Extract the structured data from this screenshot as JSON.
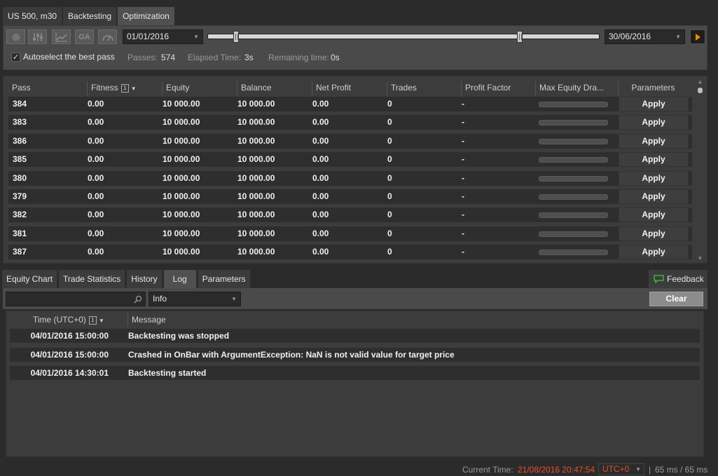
{
  "top_tabs": [
    {
      "label": "US 500, m30"
    },
    {
      "label": "Backtesting"
    },
    {
      "label": "Optimization",
      "active": true
    }
  ],
  "optimization": {
    "tool_icons": [
      "gear-icon",
      "sliders-icon",
      "line-chart-icon",
      "ga-icon",
      "speedometer-icon"
    ],
    "ga_label": "GA",
    "start_date": "01/01/2016",
    "end_date": "30/06/2016",
    "autoselect_label": "Autoselect the best pass",
    "autoselect_checked": true,
    "passes_label": "Passes:",
    "passes_value": "574",
    "elapsed_label": "Elapsed Time:",
    "elapsed_value": "3s",
    "remaining_label": "Remaining time:",
    "remaining_value": "0s"
  },
  "passes_table": {
    "columns": [
      "Pass",
      "Fitness",
      "Equity",
      "Balance",
      "Net Profit",
      "Trades",
      "Profit Factor",
      "Max Equity Dra...",
      "Parameters"
    ],
    "fitness_sort_index": "1",
    "apply_label": "Apply",
    "rows": [
      {
        "pass": "384",
        "fitness": "0.00",
        "equity": "10 000.00",
        "balance": "10 000.00",
        "net_profit": "0.00",
        "trades": "0",
        "profit_factor": "-"
      },
      {
        "pass": "383",
        "fitness": "0.00",
        "equity": "10 000.00",
        "balance": "10 000.00",
        "net_profit": "0.00",
        "trades": "0",
        "profit_factor": "-"
      },
      {
        "pass": "386",
        "fitness": "0.00",
        "equity": "10 000.00",
        "balance": "10 000.00",
        "net_profit": "0.00",
        "trades": "0",
        "profit_factor": "-"
      },
      {
        "pass": "385",
        "fitness": "0.00",
        "equity": "10 000.00",
        "balance": "10 000.00",
        "net_profit": "0.00",
        "trades": "0",
        "profit_factor": "-"
      },
      {
        "pass": "380",
        "fitness": "0.00",
        "equity": "10 000.00",
        "balance": "10 000.00",
        "net_profit": "0.00",
        "trades": "0",
        "profit_factor": "-"
      },
      {
        "pass": "379",
        "fitness": "0.00",
        "equity": "10 000.00",
        "balance": "10 000.00",
        "net_profit": "0.00",
        "trades": "0",
        "profit_factor": "-"
      },
      {
        "pass": "382",
        "fitness": "0.00",
        "equity": "10 000.00",
        "balance": "10 000.00",
        "net_profit": "0.00",
        "trades": "0",
        "profit_factor": "-"
      },
      {
        "pass": "381",
        "fitness": "0.00",
        "equity": "10 000.00",
        "balance": "10 000.00",
        "net_profit": "0.00",
        "trades": "0",
        "profit_factor": "-"
      },
      {
        "pass": "387",
        "fitness": "0.00",
        "equity": "10 000.00",
        "balance": "10 000.00",
        "net_profit": "0.00",
        "trades": "0",
        "profit_factor": "-"
      }
    ]
  },
  "bottom_tabs": [
    {
      "label": "Equity Chart"
    },
    {
      "label": "Trade Statistics"
    },
    {
      "label": "History"
    },
    {
      "label": "Log",
      "active": true
    },
    {
      "label": "Parameters"
    }
  ],
  "feedback_label": "Feedback",
  "log": {
    "search_value": "",
    "level_value": "Info",
    "clear_label": "Clear",
    "time_header": "Time (UTC+0)",
    "time_sort_index": "1",
    "message_header": "Message",
    "entries": [
      {
        "time": "04/01/2016 15:00:00",
        "message": "Backtesting was stopped"
      },
      {
        "time": "04/01/2016 15:00:00",
        "message": "Crashed in OnBar with ArgumentException: NaN is not valid value for target price"
      },
      {
        "time": "04/01/2016 14:30:01",
        "message": "Backtesting started"
      }
    ]
  },
  "status_bar": {
    "current_time_label": "Current Time:",
    "current_time_value": "21/08/2016 20:47:54",
    "timezone": "UTC+0",
    "latency": "65 ms / 65 ms"
  },
  "colors": {
    "accent_orange": "#f08a00",
    "status_red": "#e8502a"
  }
}
